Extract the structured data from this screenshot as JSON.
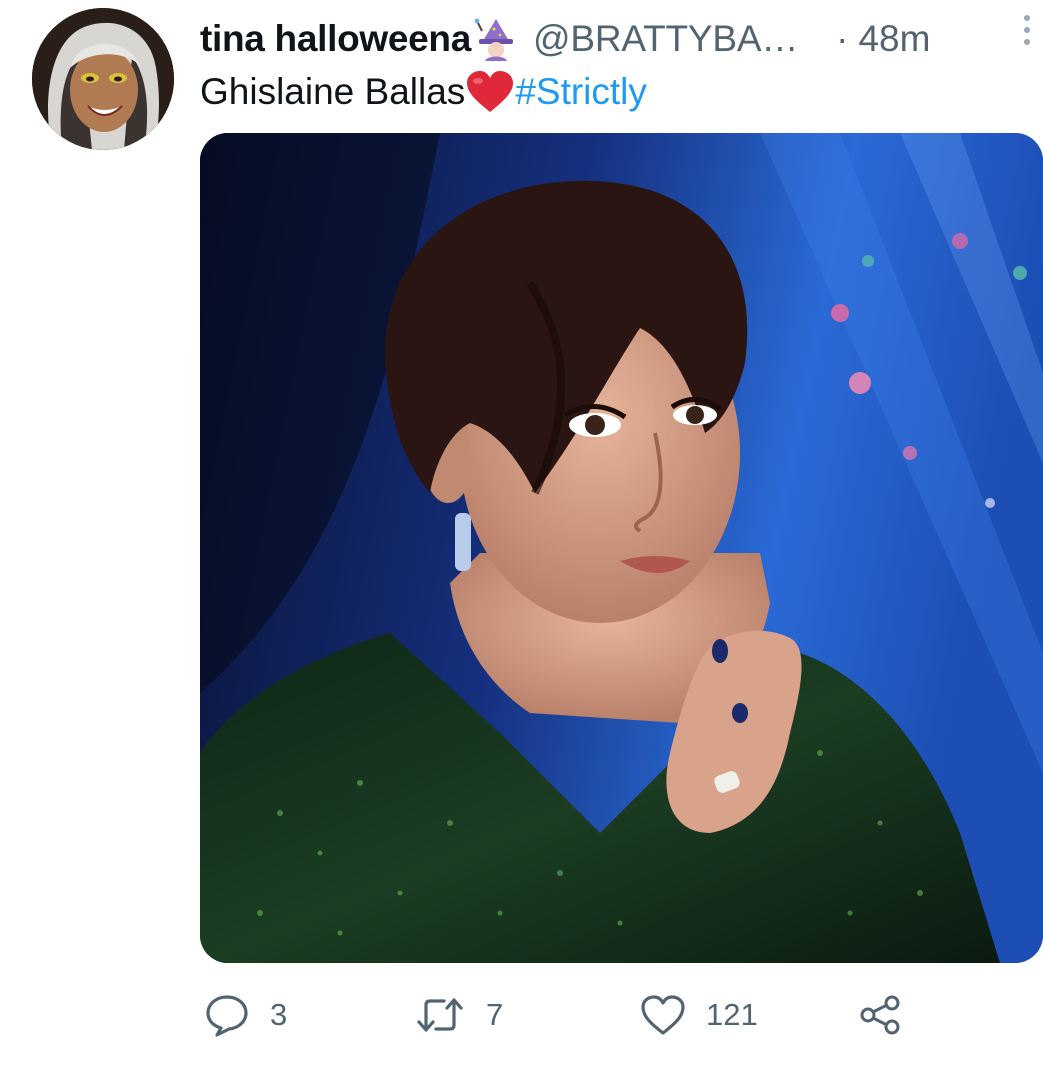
{
  "tweet": {
    "display_name": "tina halloweena",
    "handle": "@BRATTYBA…",
    "separator": "·",
    "time": "48m",
    "text": "Ghislaine Ballas",
    "hashtag": "#Strictly"
  },
  "icons": {
    "name_emoji": "woman-mage-emoji-icon",
    "text_emoji": "red-heart-emoji-icon",
    "more": "vertical-ellipsis-icon",
    "reply": "speech-bubble-icon",
    "retweet": "retweet-arrows-icon",
    "like": "heart-outline-icon",
    "share": "share-nodes-icon"
  },
  "actions": {
    "reply_count": "3",
    "retweet_count": "7",
    "like_count": "121"
  },
  "colors": {
    "link": "#1d9bf0",
    "secondary_text": "#536471",
    "primary_text": "#0f1419",
    "emoji_heart": "#e0283a"
  }
}
